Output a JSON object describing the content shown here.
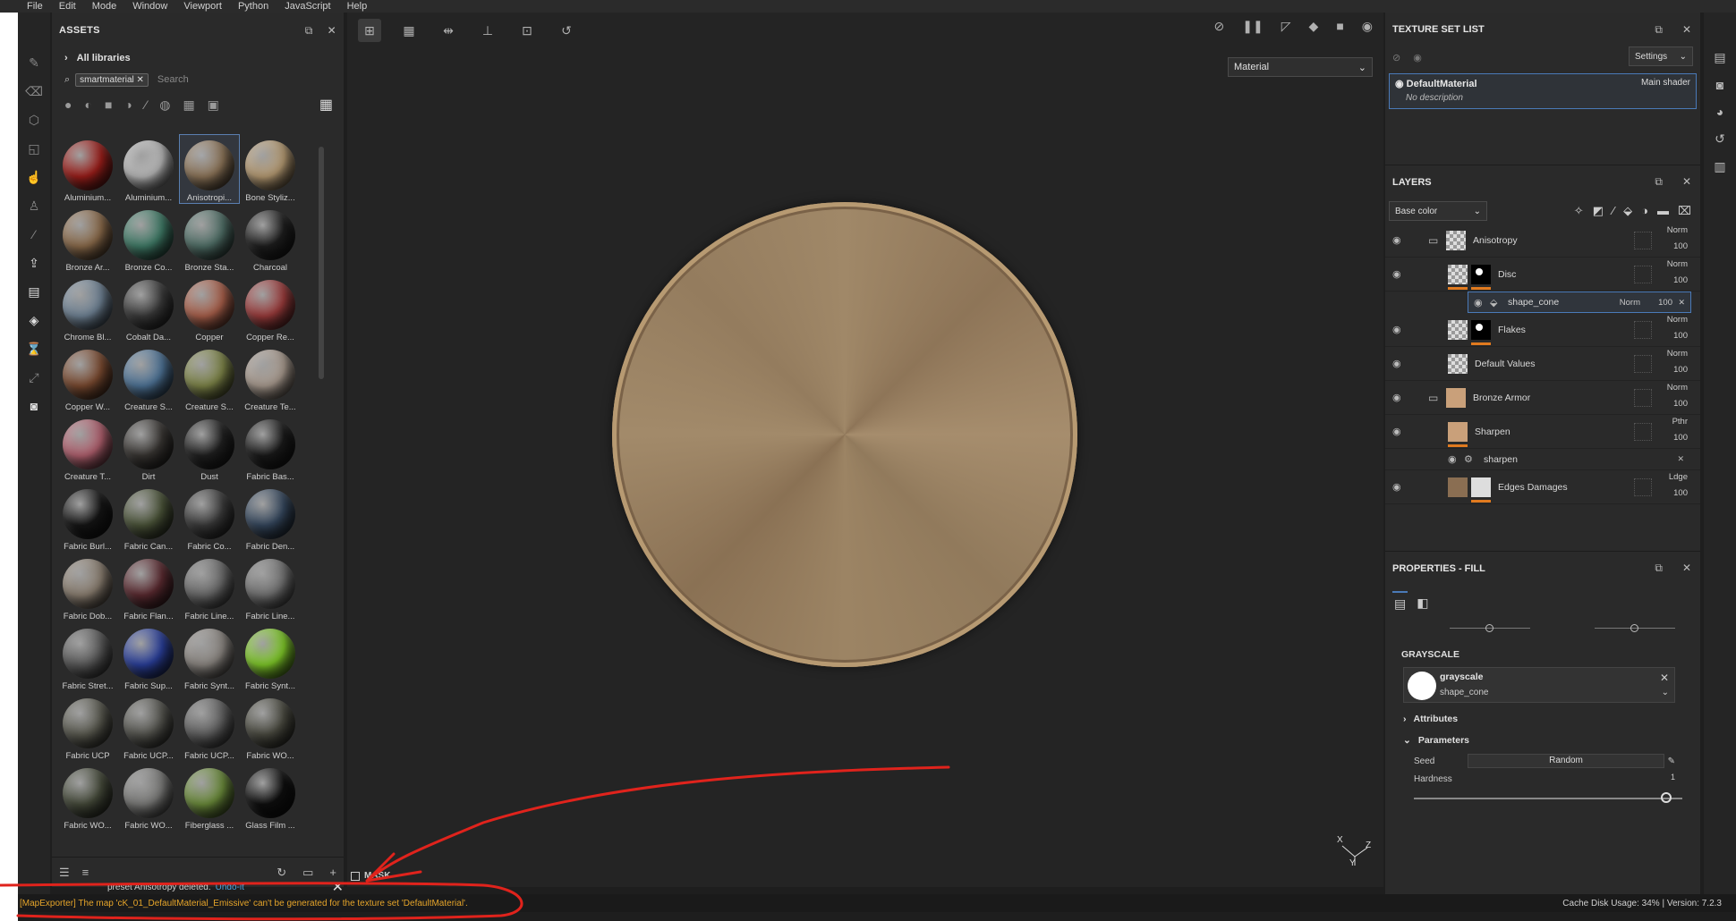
{
  "menu": [
    "File",
    "Edit",
    "Mode",
    "Window",
    "Viewport",
    "Python",
    "JavaScript",
    "Help"
  ],
  "assets": {
    "title": "ASSETS",
    "library": "All libraries",
    "search_chip": "smartmaterial",
    "search_placeholder": "Search",
    "items": [
      {
        "label": "Aluminium...",
        "color": "#9b1e1a"
      },
      {
        "label": "Aluminium...",
        "color": "#b8b8b8"
      },
      {
        "label": "Anisotropi...",
        "color": "#8c7458",
        "selected": true
      },
      {
        "label": "Bone Styliz...",
        "color": "#b59a72"
      },
      {
        "label": "Bronze Ar...",
        "color": "#8a6a4a"
      },
      {
        "label": "Bronze Co...",
        "color": "#3f7a66"
      },
      {
        "label": "Bronze Sta...",
        "color": "#4f6e66"
      },
      {
        "label": "Charcoal",
        "color": "#1e1e1e"
      },
      {
        "label": "Chrome Bl...",
        "color": "#6f8294"
      },
      {
        "label": "Cobalt Da...",
        "color": "#3a3a3a"
      },
      {
        "label": "Copper",
        "color": "#a85f4a"
      },
      {
        "label": "Copper Re...",
        "color": "#9a3b3b"
      },
      {
        "label": "Copper W...",
        "color": "#7a4a30"
      },
      {
        "label": "Creature S...",
        "color": "#4e7396"
      },
      {
        "label": "Creature S...",
        "color": "#7d8448"
      },
      {
        "label": "Creature Te...",
        "color": "#a89a8e"
      },
      {
        "label": "Creature T...",
        "color": "#b0606e"
      },
      {
        "label": "Dirt",
        "color": "#383532"
      },
      {
        "label": "Dust",
        "color": "#202020"
      },
      {
        "label": "Fabric Bas...",
        "color": "#1a1a1a"
      },
      {
        "label": "Fabric Burl...",
        "color": "#151515"
      },
      {
        "label": "Fabric Can...",
        "color": "#4a5338"
      },
      {
        "label": "Fabric Co...",
        "color": "#3a3a3a"
      },
      {
        "label": "Fabric Den...",
        "color": "#34465c"
      },
      {
        "label": "Fabric Dob...",
        "color": "#8a7e70"
      },
      {
        "label": "Fabric Flan...",
        "color": "#5a2a30"
      },
      {
        "label": "Fabric Line...",
        "color": "#6a6a6a"
      },
      {
        "label": "Fabric Line...",
        "color": "#727272"
      },
      {
        "label": "Fabric Stret...",
        "color": "#5a5a5a"
      },
      {
        "label": "Fabric Sup...",
        "color": "#2a3f9a"
      },
      {
        "label": "Fabric Synt...",
        "color": "#8a8580"
      },
      {
        "label": "Fabric Synt...",
        "color": "#7ec828"
      },
      {
        "label": "Fabric UCP",
        "color": "#5a5a50"
      },
      {
        "label": "Fabric UCP...",
        "color": "#55554f"
      },
      {
        "label": "Fabric UCP...",
        "color": "#606060"
      },
      {
        "label": "Fabric WO...",
        "color": "#4a4a40"
      },
      {
        "label": "Fabric WO...",
        "color": "#454a3a"
      },
      {
        "label": "Fabric WO...",
        "color": "#7a7a78"
      },
      {
        "label": "Fiberglass ...",
        "color": "#6a8a3a"
      },
      {
        "label": "Glass Film ...",
        "color": "#0e0e0e"
      }
    ]
  },
  "toast": {
    "text": "preset Anisotropy deleted.",
    "undo": "Undo-it"
  },
  "viewport": {
    "material_select": "Material",
    "mask_label": "MASK",
    "axis_x": "X",
    "axis_y": "Y",
    "axis_z": "Z"
  },
  "statusbar": {
    "message": "[MapExporter] The map 'cK_01_DefaultMaterial_Emissive' can't be generated for the texture set 'DefaultMaterial'.",
    "right": "Cache Disk Usage:   34% | Version: 7.2.3"
  },
  "texture_set_list": {
    "title": "TEXTURE SET LIST",
    "settings": "Settings",
    "item_name": "DefaultMaterial",
    "item_desc": "No description",
    "item_shader": "Main shader"
  },
  "layers": {
    "title": "LAYERS",
    "channel": "Base color",
    "rows": [
      {
        "name": "Anisotropy",
        "blend": "Norm",
        "opacity": "100",
        "type": "folder"
      },
      {
        "name": "Disc",
        "blend": "Norm",
        "opacity": "100",
        "type": "fill-mask"
      },
      {
        "name": "shape_cone",
        "blend": "Norm",
        "opacity": "100",
        "type": "effect"
      },
      {
        "name": "Flakes",
        "blend": "Norm",
        "opacity": "100",
        "type": "fill-mask"
      },
      {
        "name": "Default Values",
        "blend": "Norm",
        "opacity": "100",
        "type": "fill"
      },
      {
        "name": "Bronze Armor",
        "blend": "Norm",
        "opacity": "100",
        "type": "folder-bronze"
      },
      {
        "name": "Sharpen",
        "blend": "Pthr",
        "opacity": "100",
        "type": "bronze"
      },
      {
        "name": "sharpen",
        "type": "effect-plain"
      },
      {
        "name": "Edges Damages",
        "blend": "Ldge",
        "opacity": "100",
        "type": "bronze-white"
      }
    ]
  },
  "properties": {
    "title": "PROPERTIES - FILL",
    "grayscale_title": "GRAYSCALE",
    "grayscale_name": "grayscale",
    "grayscale_sub": "shape_cone",
    "attributes": "Attributes",
    "parameters": "Parameters",
    "seed_label": "Seed",
    "seed_value": "Random",
    "hardness_label": "Hardness",
    "hardness_value": "1"
  }
}
